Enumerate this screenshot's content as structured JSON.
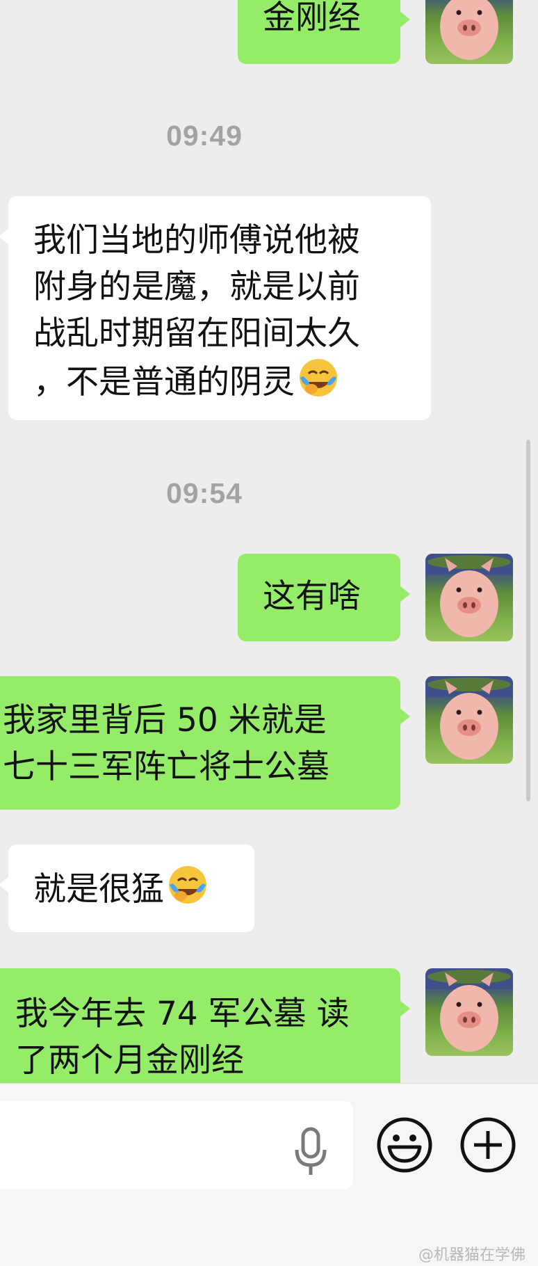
{
  "messages": [
    {
      "type": "outgoing",
      "lines": [
        "金刚经"
      ]
    },
    {
      "type": "time",
      "text": "09:49"
    },
    {
      "type": "incoming",
      "lines": [
        "我们当地的师傅说他被",
        "附身的是魔，就是以前",
        "战乱时期留在阳间太久",
        "，不是普通的阴灵"
      ],
      "emoji": "face-with-tears-of-joy"
    },
    {
      "type": "time",
      "text": "09:54"
    },
    {
      "type": "outgoing",
      "lines": [
        "这有啥"
      ]
    },
    {
      "type": "outgoing",
      "lines": [
        "我家里背后 50 米就是",
        "七十三军阵亡将士公墓"
      ]
    },
    {
      "type": "incoming",
      "lines": [
        "就是很猛"
      ],
      "emoji": "face-with-tears-of-joy"
    },
    {
      "type": "outgoing",
      "lines": [
        "我今年去 74 军公墓 读",
        "了两个月金刚经"
      ]
    }
  ],
  "input": {
    "placeholder": "",
    "value": ""
  },
  "icons": {
    "voice": "microphone-icon",
    "sticker": "emoji-icon",
    "more": "plus-icon"
  },
  "avatar_name": "pig-avatar",
  "colors": {
    "outgoing_bubble": "#95ec69",
    "incoming_bubble": "#ffffff",
    "background": "#ededed",
    "timestamp": "#a3a3a3"
  },
  "watermark": "@机器猫在学佛"
}
